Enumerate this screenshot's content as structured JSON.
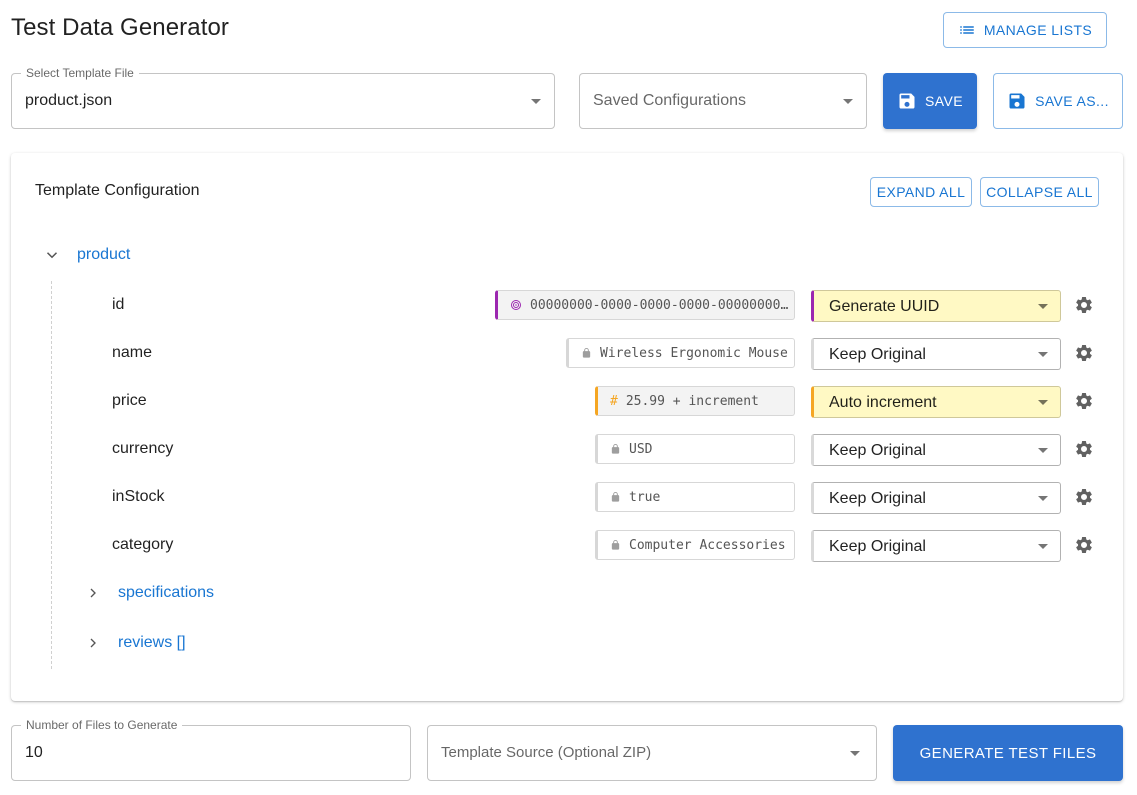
{
  "header": {
    "title": "Test Data Generator",
    "manage_lists_label": "MANAGE LISTS"
  },
  "template_select": {
    "label": "Select Template File",
    "value": "product.json"
  },
  "saved_configs": {
    "placeholder": "Saved Configurations"
  },
  "save_label": "SAVE",
  "save_as_label": "SAVE AS...",
  "config": {
    "title": "Template Configuration",
    "expand_all_label": "EXPAND ALL",
    "collapse_all_label": "COLLAPSE ALL",
    "root": {
      "label": "product",
      "fields": [
        {
          "name": "id",
          "value": "00000000-0000-0000-0000-00000000…",
          "strategy": "Generate UUID"
        },
        {
          "name": "name",
          "value": "Wireless Ergonomic Mouse",
          "strategy": "Keep Original"
        },
        {
          "name": "price",
          "value": "25.99 + increment",
          "strategy": "Auto increment"
        },
        {
          "name": "currency",
          "value": "USD",
          "strategy": "Keep Original"
        },
        {
          "name": "inStock",
          "value": "true",
          "strategy": "Keep Original"
        },
        {
          "name": "category",
          "value": "Computer Accessories",
          "strategy": "Keep Original"
        }
      ],
      "children": [
        {
          "label": "specifications"
        },
        {
          "label": "reviews []"
        }
      ]
    }
  },
  "files_to_generate": {
    "label": "Number of Files to Generate",
    "value": "10"
  },
  "template_source": {
    "placeholder": "Template Source (Optional ZIP)"
  },
  "generate_label": "GENERATE TEST FILES",
  "colors": {
    "primary": "#1976d2",
    "uuid_accent": "#9c27b0",
    "increment_accent": "#f5a623",
    "highlight_bg": "#fff9c4"
  }
}
